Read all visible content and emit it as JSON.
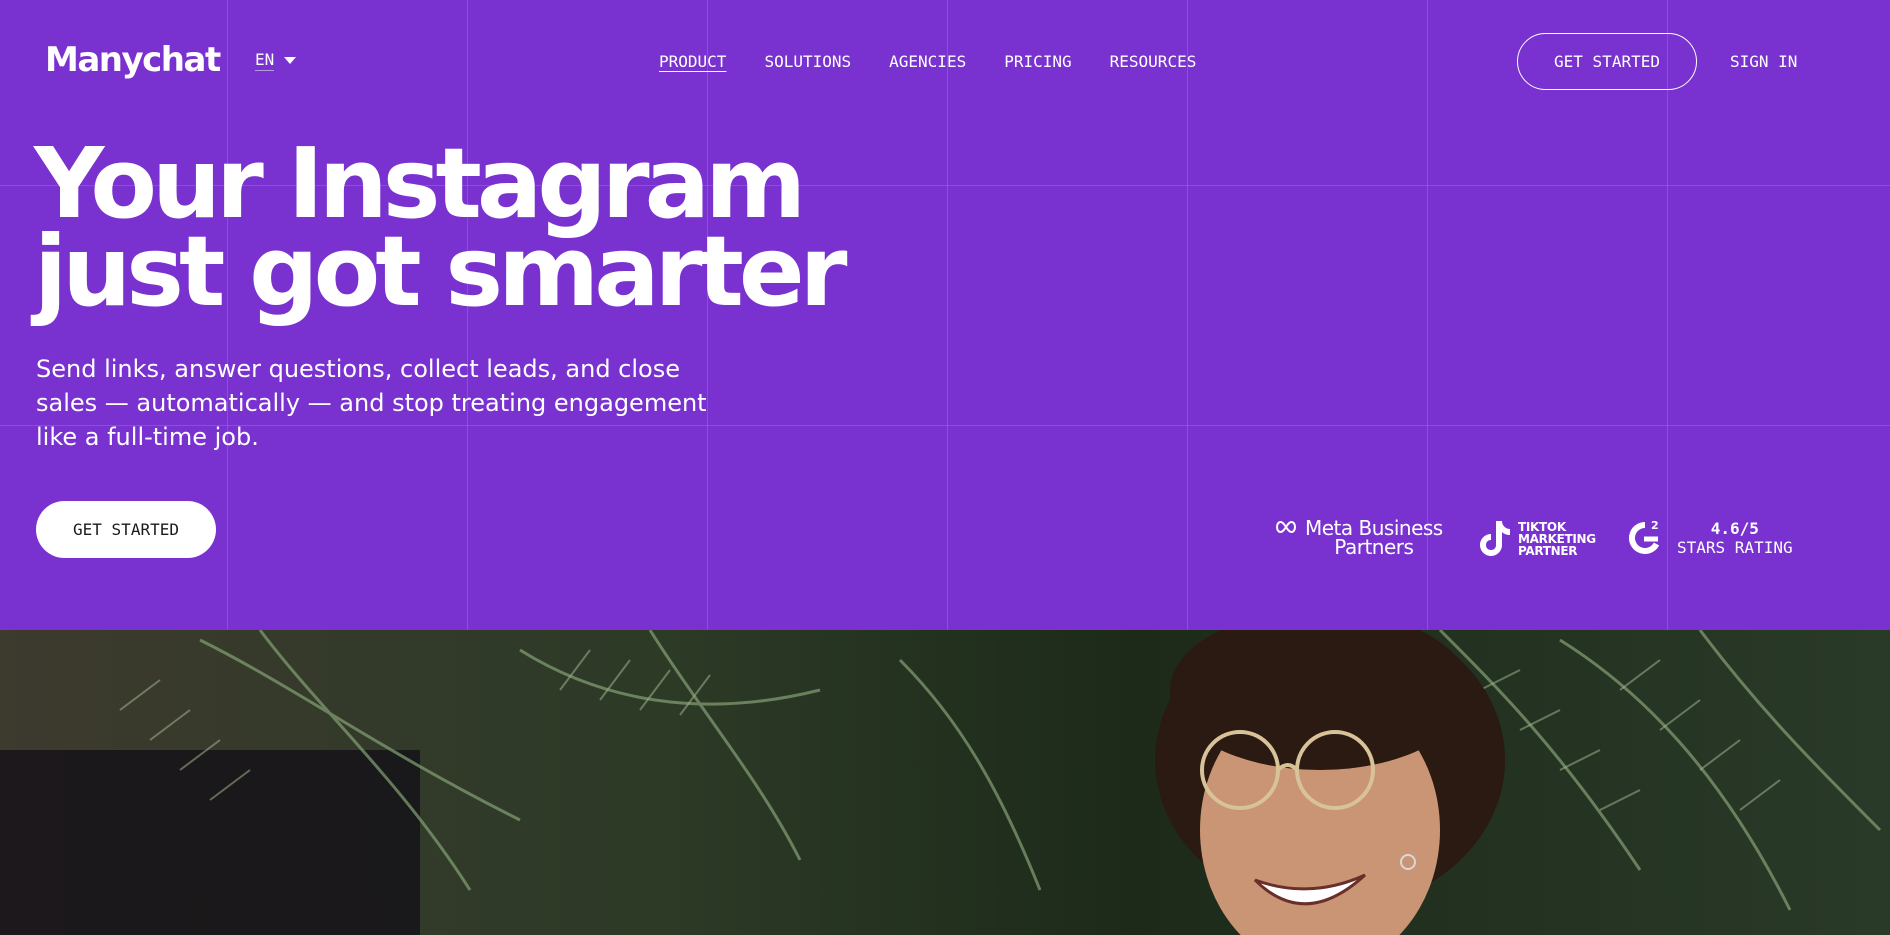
{
  "brand": {
    "logo_text": "Manychat"
  },
  "language": {
    "code": "EN"
  },
  "nav": {
    "items": [
      {
        "label": "PRODUCT",
        "active": true
      },
      {
        "label": "SOLUTIONS"
      },
      {
        "label": "AGENCIES"
      },
      {
        "label": "PRICING"
      },
      {
        "label": "RESOURCES"
      }
    ]
  },
  "header": {
    "get_started_label": "GET STARTED",
    "sign_in_label": "SIGN IN"
  },
  "hero": {
    "headline_line1": "Your Instagram",
    "headline_line2": "just got smarter",
    "subhead": "Send links, answer questions, collect leads, and close sales — automatically — and stop treating engagement like a full-time job.",
    "cta_label": "GET STARTED"
  },
  "badges": {
    "meta_line1": "Meta Business",
    "meta_line2": "Partners",
    "tiktok_line1": "TIKTOK",
    "tiktok_line2": "MARKETING",
    "tiktok_line3": "PARTNER",
    "g2_score": "4.6/5",
    "g2_label": "STARS RATING"
  },
  "colors": {
    "brand_purple": "#7932cf",
    "white": "#ffffff"
  },
  "icons": [
    "chevron-down-icon",
    "meta-infinity-icon",
    "tiktok-icon",
    "g2-icon"
  ]
}
